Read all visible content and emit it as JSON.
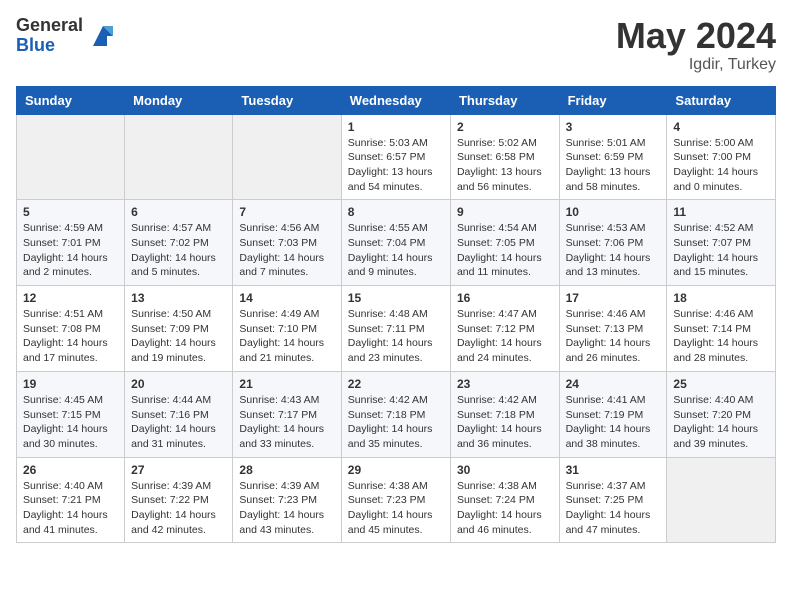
{
  "logo": {
    "general": "General",
    "blue": "Blue"
  },
  "title": {
    "month_year": "May 2024",
    "location": "Igdir, Turkey"
  },
  "days_of_week": [
    "Sunday",
    "Monday",
    "Tuesday",
    "Wednesday",
    "Thursday",
    "Friday",
    "Saturday"
  ],
  "weeks": [
    [
      {
        "day": "",
        "sunrise": "",
        "sunset": "",
        "daylight": "",
        "empty": true
      },
      {
        "day": "",
        "sunrise": "",
        "sunset": "",
        "daylight": "",
        "empty": true
      },
      {
        "day": "",
        "sunrise": "",
        "sunset": "",
        "daylight": "",
        "empty": true
      },
      {
        "day": "1",
        "sunrise": "Sunrise: 5:03 AM",
        "sunset": "Sunset: 6:57 PM",
        "daylight": "Daylight: 13 hours and 54 minutes."
      },
      {
        "day": "2",
        "sunrise": "Sunrise: 5:02 AM",
        "sunset": "Sunset: 6:58 PM",
        "daylight": "Daylight: 13 hours and 56 minutes."
      },
      {
        "day": "3",
        "sunrise": "Sunrise: 5:01 AM",
        "sunset": "Sunset: 6:59 PM",
        "daylight": "Daylight: 13 hours and 58 minutes."
      },
      {
        "day": "4",
        "sunrise": "Sunrise: 5:00 AM",
        "sunset": "Sunset: 7:00 PM",
        "daylight": "Daylight: 14 hours and 0 minutes."
      }
    ],
    [
      {
        "day": "5",
        "sunrise": "Sunrise: 4:59 AM",
        "sunset": "Sunset: 7:01 PM",
        "daylight": "Daylight: 14 hours and 2 minutes."
      },
      {
        "day": "6",
        "sunrise": "Sunrise: 4:57 AM",
        "sunset": "Sunset: 7:02 PM",
        "daylight": "Daylight: 14 hours and 5 minutes."
      },
      {
        "day": "7",
        "sunrise": "Sunrise: 4:56 AM",
        "sunset": "Sunset: 7:03 PM",
        "daylight": "Daylight: 14 hours and 7 minutes."
      },
      {
        "day": "8",
        "sunrise": "Sunrise: 4:55 AM",
        "sunset": "Sunset: 7:04 PM",
        "daylight": "Daylight: 14 hours and 9 minutes."
      },
      {
        "day": "9",
        "sunrise": "Sunrise: 4:54 AM",
        "sunset": "Sunset: 7:05 PM",
        "daylight": "Daylight: 14 hours and 11 minutes."
      },
      {
        "day": "10",
        "sunrise": "Sunrise: 4:53 AM",
        "sunset": "Sunset: 7:06 PM",
        "daylight": "Daylight: 14 hours and 13 minutes."
      },
      {
        "day": "11",
        "sunrise": "Sunrise: 4:52 AM",
        "sunset": "Sunset: 7:07 PM",
        "daylight": "Daylight: 14 hours and 15 minutes."
      }
    ],
    [
      {
        "day": "12",
        "sunrise": "Sunrise: 4:51 AM",
        "sunset": "Sunset: 7:08 PM",
        "daylight": "Daylight: 14 hours and 17 minutes."
      },
      {
        "day": "13",
        "sunrise": "Sunrise: 4:50 AM",
        "sunset": "Sunset: 7:09 PM",
        "daylight": "Daylight: 14 hours and 19 minutes."
      },
      {
        "day": "14",
        "sunrise": "Sunrise: 4:49 AM",
        "sunset": "Sunset: 7:10 PM",
        "daylight": "Daylight: 14 hours and 21 minutes."
      },
      {
        "day": "15",
        "sunrise": "Sunrise: 4:48 AM",
        "sunset": "Sunset: 7:11 PM",
        "daylight": "Daylight: 14 hours and 23 minutes."
      },
      {
        "day": "16",
        "sunrise": "Sunrise: 4:47 AM",
        "sunset": "Sunset: 7:12 PM",
        "daylight": "Daylight: 14 hours and 24 minutes."
      },
      {
        "day": "17",
        "sunrise": "Sunrise: 4:46 AM",
        "sunset": "Sunset: 7:13 PM",
        "daylight": "Daylight: 14 hours and 26 minutes."
      },
      {
        "day": "18",
        "sunrise": "Sunrise: 4:46 AM",
        "sunset": "Sunset: 7:14 PM",
        "daylight": "Daylight: 14 hours and 28 minutes."
      }
    ],
    [
      {
        "day": "19",
        "sunrise": "Sunrise: 4:45 AM",
        "sunset": "Sunset: 7:15 PM",
        "daylight": "Daylight: 14 hours and 30 minutes."
      },
      {
        "day": "20",
        "sunrise": "Sunrise: 4:44 AM",
        "sunset": "Sunset: 7:16 PM",
        "daylight": "Daylight: 14 hours and 31 minutes."
      },
      {
        "day": "21",
        "sunrise": "Sunrise: 4:43 AM",
        "sunset": "Sunset: 7:17 PM",
        "daylight": "Daylight: 14 hours and 33 minutes."
      },
      {
        "day": "22",
        "sunrise": "Sunrise: 4:42 AM",
        "sunset": "Sunset: 7:18 PM",
        "daylight": "Daylight: 14 hours and 35 minutes."
      },
      {
        "day": "23",
        "sunrise": "Sunrise: 4:42 AM",
        "sunset": "Sunset: 7:18 PM",
        "daylight": "Daylight: 14 hours and 36 minutes."
      },
      {
        "day": "24",
        "sunrise": "Sunrise: 4:41 AM",
        "sunset": "Sunset: 7:19 PM",
        "daylight": "Daylight: 14 hours and 38 minutes."
      },
      {
        "day": "25",
        "sunrise": "Sunrise: 4:40 AM",
        "sunset": "Sunset: 7:20 PM",
        "daylight": "Daylight: 14 hours and 39 minutes."
      }
    ],
    [
      {
        "day": "26",
        "sunrise": "Sunrise: 4:40 AM",
        "sunset": "Sunset: 7:21 PM",
        "daylight": "Daylight: 14 hours and 41 minutes."
      },
      {
        "day": "27",
        "sunrise": "Sunrise: 4:39 AM",
        "sunset": "Sunset: 7:22 PM",
        "daylight": "Daylight: 14 hours and 42 minutes."
      },
      {
        "day": "28",
        "sunrise": "Sunrise: 4:39 AM",
        "sunset": "Sunset: 7:23 PM",
        "daylight": "Daylight: 14 hours and 43 minutes."
      },
      {
        "day": "29",
        "sunrise": "Sunrise: 4:38 AM",
        "sunset": "Sunset: 7:23 PM",
        "daylight": "Daylight: 14 hours and 45 minutes."
      },
      {
        "day": "30",
        "sunrise": "Sunrise: 4:38 AM",
        "sunset": "Sunset: 7:24 PM",
        "daylight": "Daylight: 14 hours and 46 minutes."
      },
      {
        "day": "31",
        "sunrise": "Sunrise: 4:37 AM",
        "sunset": "Sunset: 7:25 PM",
        "daylight": "Daylight: 14 hours and 47 minutes."
      },
      {
        "day": "",
        "sunrise": "",
        "sunset": "",
        "daylight": "",
        "empty": true
      }
    ]
  ]
}
